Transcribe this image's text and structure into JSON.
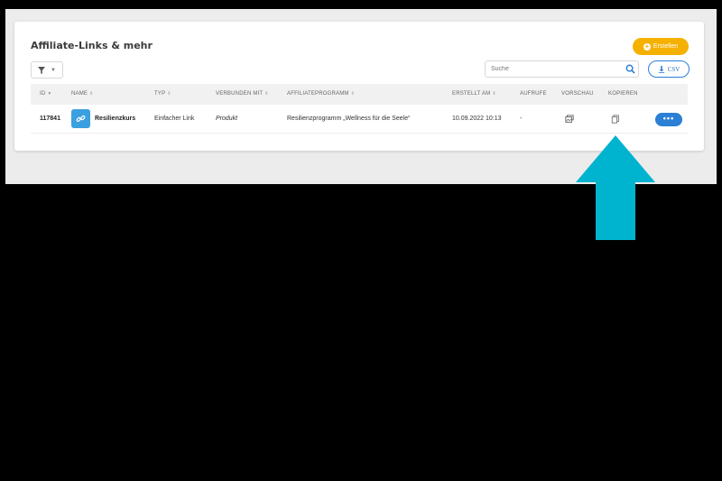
{
  "page": {
    "title": "Affiliate-Links & mehr",
    "create_label": "Erstellen",
    "csv_label": "CSV",
    "search": {
      "placeholder": "Suche"
    }
  },
  "table": {
    "columns": [
      {
        "label": "ID"
      },
      {
        "label": "NAME"
      },
      {
        "label": "TYP"
      },
      {
        "label": "VERBUNDEN MIT"
      },
      {
        "label": "AFFILIATEPROGRAMM"
      },
      {
        "label": "ERSTELLT AM"
      },
      {
        "label": "AUFRUFE"
      },
      {
        "label": "VORSCHAU"
      },
      {
        "label": "KOPIEREN"
      }
    ],
    "rows": [
      {
        "id": "117841",
        "name": "Resilienzkurs",
        "type": "Einfacher Link",
        "connected": "Produkt",
        "program": "Resilienzprogramm „Wellness für die Seele“",
        "created": "10.09.2022 10:13",
        "views": "-",
        "more_label": "•••"
      }
    ]
  },
  "icons": {
    "filter": "filter-icon",
    "search": "search-icon",
    "download": "download-icon",
    "link": "link-icon",
    "preview": "preview-icon",
    "copy": "copy-icon",
    "create": "plus-circle-icon"
  },
  "colors": {
    "accent_orange": "#f5b100",
    "primary_blue": "#2b7fd4",
    "link_icon_bg": "#3aa0e0",
    "annotation_arrow": "#00b4d0"
  }
}
